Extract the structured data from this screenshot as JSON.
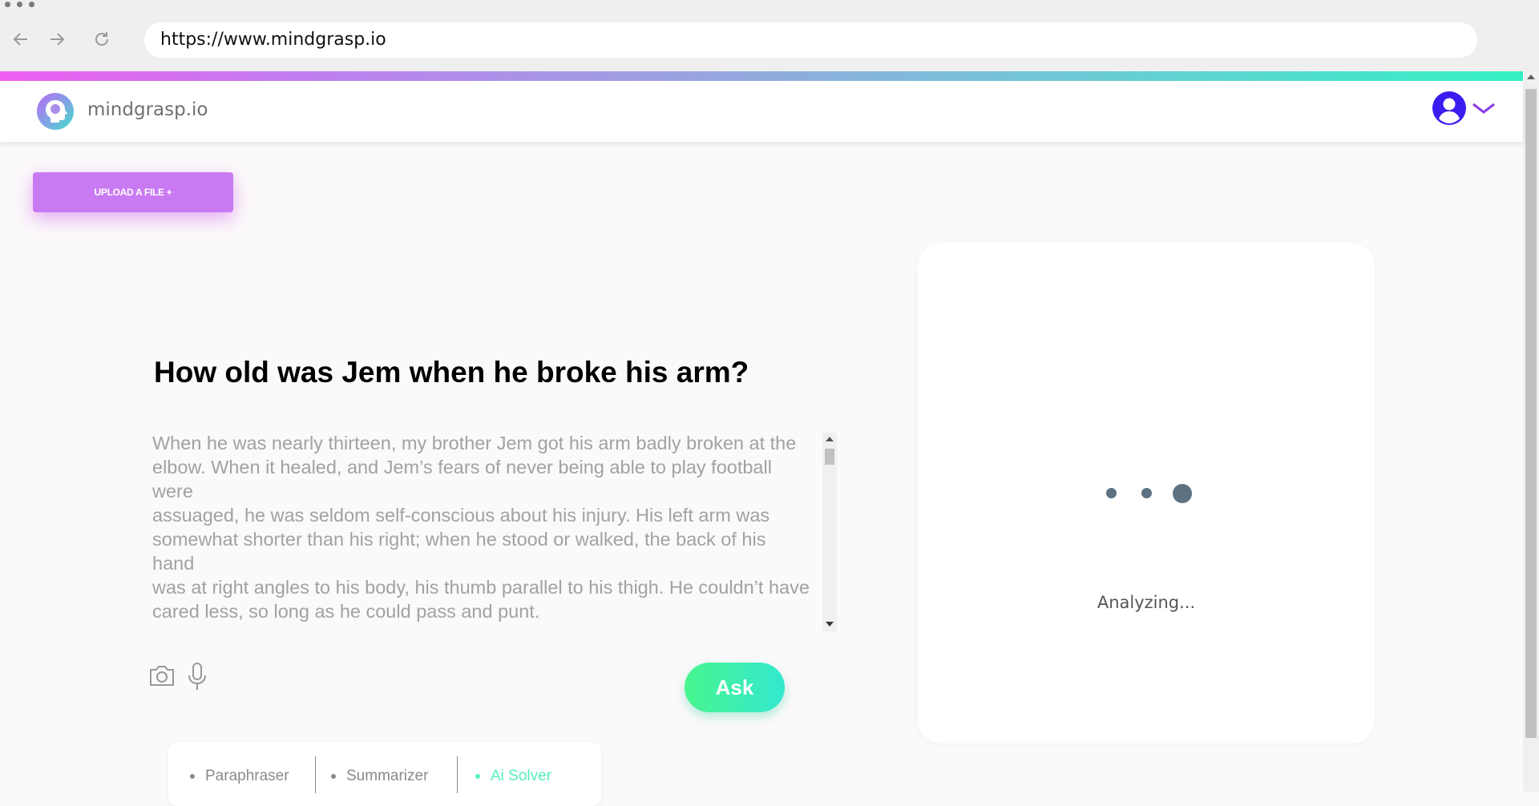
{
  "browser": {
    "url": "https://www.mindgrasp.io"
  },
  "header": {
    "logo_text": "mindgrasp.io"
  },
  "upload_button": {
    "label": "UPLOAD A FILE +"
  },
  "question": "How old was Jem when he broke his arm?",
  "passage": "When he was nearly thirteen, my brother Jem got his arm badly broken at the\nelbow. When it healed, and Jem’s fears of never being able to play football were\nassuaged, he was seldom self-conscious about his injury. His left arm was somewhat shorter than his right; when he stood or walked, the back of his hand\nwas at right angles to his body, his thumb parallel to his thigh. He couldn’t have cared less, so long as he could pass and punt.",
  "ask_button": {
    "label": "Ask"
  },
  "tools": [
    {
      "label": "Paraphraser",
      "active": false
    },
    {
      "label": "Summarizer",
      "active": false
    },
    {
      "label": "Ai Solver",
      "active": true
    }
  ],
  "result_panel": {
    "status": "Analyzing..."
  },
  "colors": {
    "accent_purple": "#c97af2",
    "accent_green": "#48f58e",
    "accent_teal": "#33e8cf",
    "loader": "#5c7181",
    "avatar_blue": "#3b1df0"
  }
}
